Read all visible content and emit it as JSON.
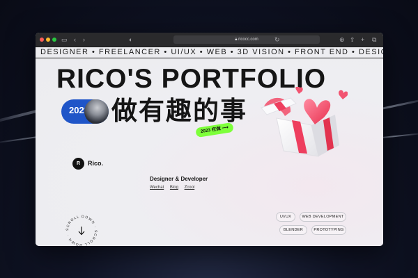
{
  "browser": {
    "url": "ricocc.com",
    "traffic_light_colors": [
      "#ff5f57",
      "#febc2e",
      "#28c840"
    ]
  },
  "marquee": {
    "text": "DESIGNER  •  FREELANCER  •  UI/UX  •  WEB  •  3D VISION  •  FRONT END  •  DESIGNER"
  },
  "hero": {
    "title": "RICO'S PORTFOLIO",
    "year": "2023",
    "subtitle_zh": "做有趣的事",
    "tag": "2023 在做 ⟶"
  },
  "profile": {
    "logo_text": "R",
    "brand": "Rico.",
    "role": "Designer & Developer",
    "links": [
      "Wechat",
      "Blog",
      "Zcool"
    ]
  },
  "skills": [
    "UI/UX",
    "WEB DEVELOPMENT",
    "BLENDER",
    "PROTOTYPING"
  ],
  "scroll": {
    "ring_text": "SCROLL DOWN · SCROLL DOWN ·"
  },
  "colors": {
    "accent_blue": "#1f55c8",
    "tag_green": "#7dff3a",
    "gift_red": "#ee3e5e"
  }
}
